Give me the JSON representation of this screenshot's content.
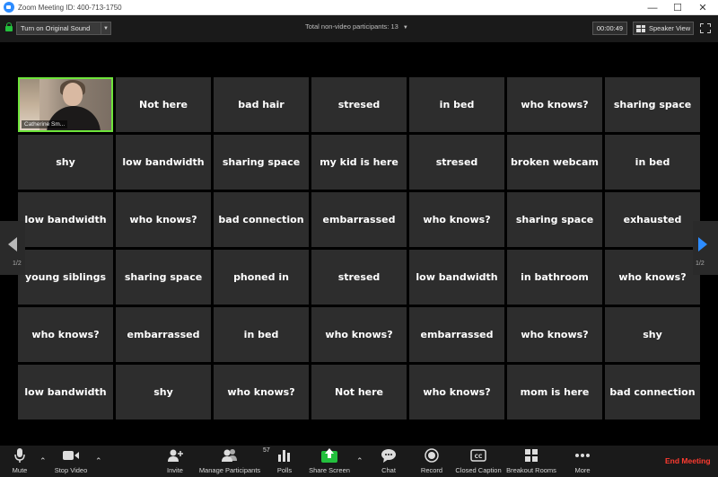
{
  "window": {
    "title": "Zoom Meeting ID: 400-713-1750",
    "controls": [
      "minimize-icon",
      "maximize-icon",
      "close-icon"
    ]
  },
  "topbar": {
    "original_sound": "Turn on Original Sound",
    "total_non_video": "Total non-video participants: 13",
    "timer": "00:00:49",
    "view": "Speaker View"
  },
  "participant_video": {
    "name": "Catherine Sm..."
  },
  "grid": [
    [
      "",
      "Not here",
      "bad hair",
      "stresed",
      "in bed",
      "who knows?",
      "sharing space"
    ],
    [
      "shy",
      "low bandwidth",
      "sharing space",
      "my kid is here",
      "stresed",
      "broken webcam",
      "in bed"
    ],
    [
      "low bandwidth",
      "who knows?",
      "bad connection",
      "embarrassed",
      "who knows?",
      "sharing space",
      "exhausted"
    ],
    [
      "young siblings",
      "sharing space",
      "phoned in",
      "stresed",
      "low bandwidth",
      "in bathroom",
      "who knows?"
    ],
    [
      "who knows?",
      "embarrassed",
      "in bed",
      "who knows?",
      "embarrassed",
      "who knows?",
      "shy"
    ],
    [
      "low bandwidth",
      "shy",
      "who knows?",
      "Not here",
      "who knows?",
      "mom is here",
      "bad connection"
    ]
  ],
  "pager": {
    "left": "1/2",
    "right": "1/2"
  },
  "toolbar": {
    "mute": "Mute",
    "stop_video": "Stop Video",
    "invite": "Invite",
    "manage": "Manage Participants",
    "participant_count": "57",
    "polls": "Polls",
    "share": "Share Screen",
    "chat": "Chat",
    "record": "Record",
    "closed_caption": "Closed Caption",
    "breakout": "Breakout Rooms",
    "more": "More",
    "end": "End Meeting"
  },
  "colors": {
    "accent_green": "#23c03d",
    "active_speaker_border": "#6ee43b",
    "end_meeting_red": "#ff3b30",
    "tile_bg": "#2d2d2d",
    "pager_arrow": "#2d8cff"
  }
}
